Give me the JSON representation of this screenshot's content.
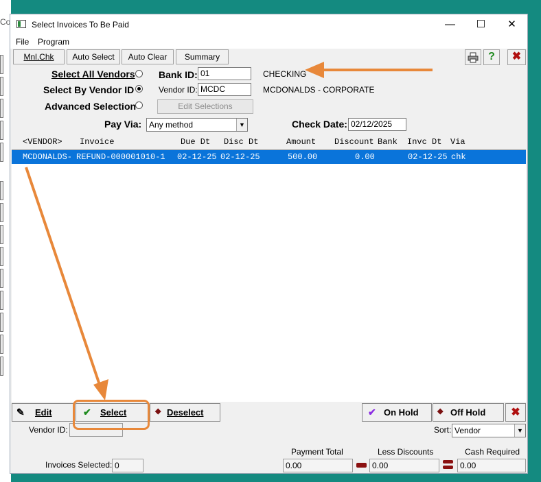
{
  "background": {
    "fragment": "Cor"
  },
  "window": {
    "title": "Select Invoices To Be Paid",
    "minimize_glyph": "—",
    "maximize_glyph": "☐",
    "close_glyph": "✕"
  },
  "menu": [
    "File",
    "Program"
  ],
  "toolbar": {
    "buttons": [
      "Mnl.Chk",
      "Auto Select",
      "Auto Clear",
      "Summary"
    ],
    "print_icon": "printer-icon",
    "help_glyph": "?",
    "close_glyph": "✖"
  },
  "form": {
    "select_all_vendors": "Select All Vendors",
    "select_by_vendor_id": "Select By Vendor ID",
    "advanced_selection": "Advanced Selection",
    "bank_id_label": "Bank ID:",
    "bank_id_value": "01",
    "bank_name": "CHECKING",
    "vendor_id_label": "Vendor ID:",
    "vendor_id_value": "MCDC",
    "vendor_name": "MCDONALDS - CORPORATE",
    "edit_selections": "Edit Selections",
    "pay_via_label": "Pay Via:",
    "pay_via_value": "Any method",
    "check_date_label": "Check Date:",
    "check_date_value": "02/12/2025",
    "selected_radio": "select_by_vendor_id"
  },
  "columns": [
    "<VENDOR>",
    "Invoice",
    "Due Dt",
    "Disc Dt",
    "Amount",
    "Discount",
    "Bank",
    "Invc Dt",
    "Via"
  ],
  "rows": [
    {
      "vendor": "MCDONALDS-",
      "invoice": "REFUND-000001010-1",
      "due_dt": "02-12-25",
      "disc_dt": "02-12-25",
      "amount": "500.00",
      "discount": "0.00",
      "bank": "",
      "invc_dt": "02-12-25",
      "via": "chk",
      "selected": true
    }
  ],
  "bottom_buttons": {
    "edit": "Edit",
    "select": "Select",
    "deselect": "Deselect",
    "on_hold": "On Hold",
    "off_hold": "Off Hold",
    "close_glyph": "✖"
  },
  "footer": {
    "vendor_id_label": "Vendor ID:",
    "vendor_id_value": "",
    "sort_label": "Sort:",
    "sort_value": "Vendor",
    "invoices_selected_label": "Invoices Selected:",
    "invoices_selected_value": "0",
    "payment_total_label": "Payment Total",
    "payment_total_value": "0.00",
    "less_discounts_label": "Less Discounts",
    "less_discounts_value": "0.00",
    "cash_required_label": "Cash Required",
    "cash_required_value": "0.00"
  },
  "colors": {
    "accent_annotation": "#e8883a",
    "selection": "#0a74da",
    "desktop": "#148a80"
  }
}
